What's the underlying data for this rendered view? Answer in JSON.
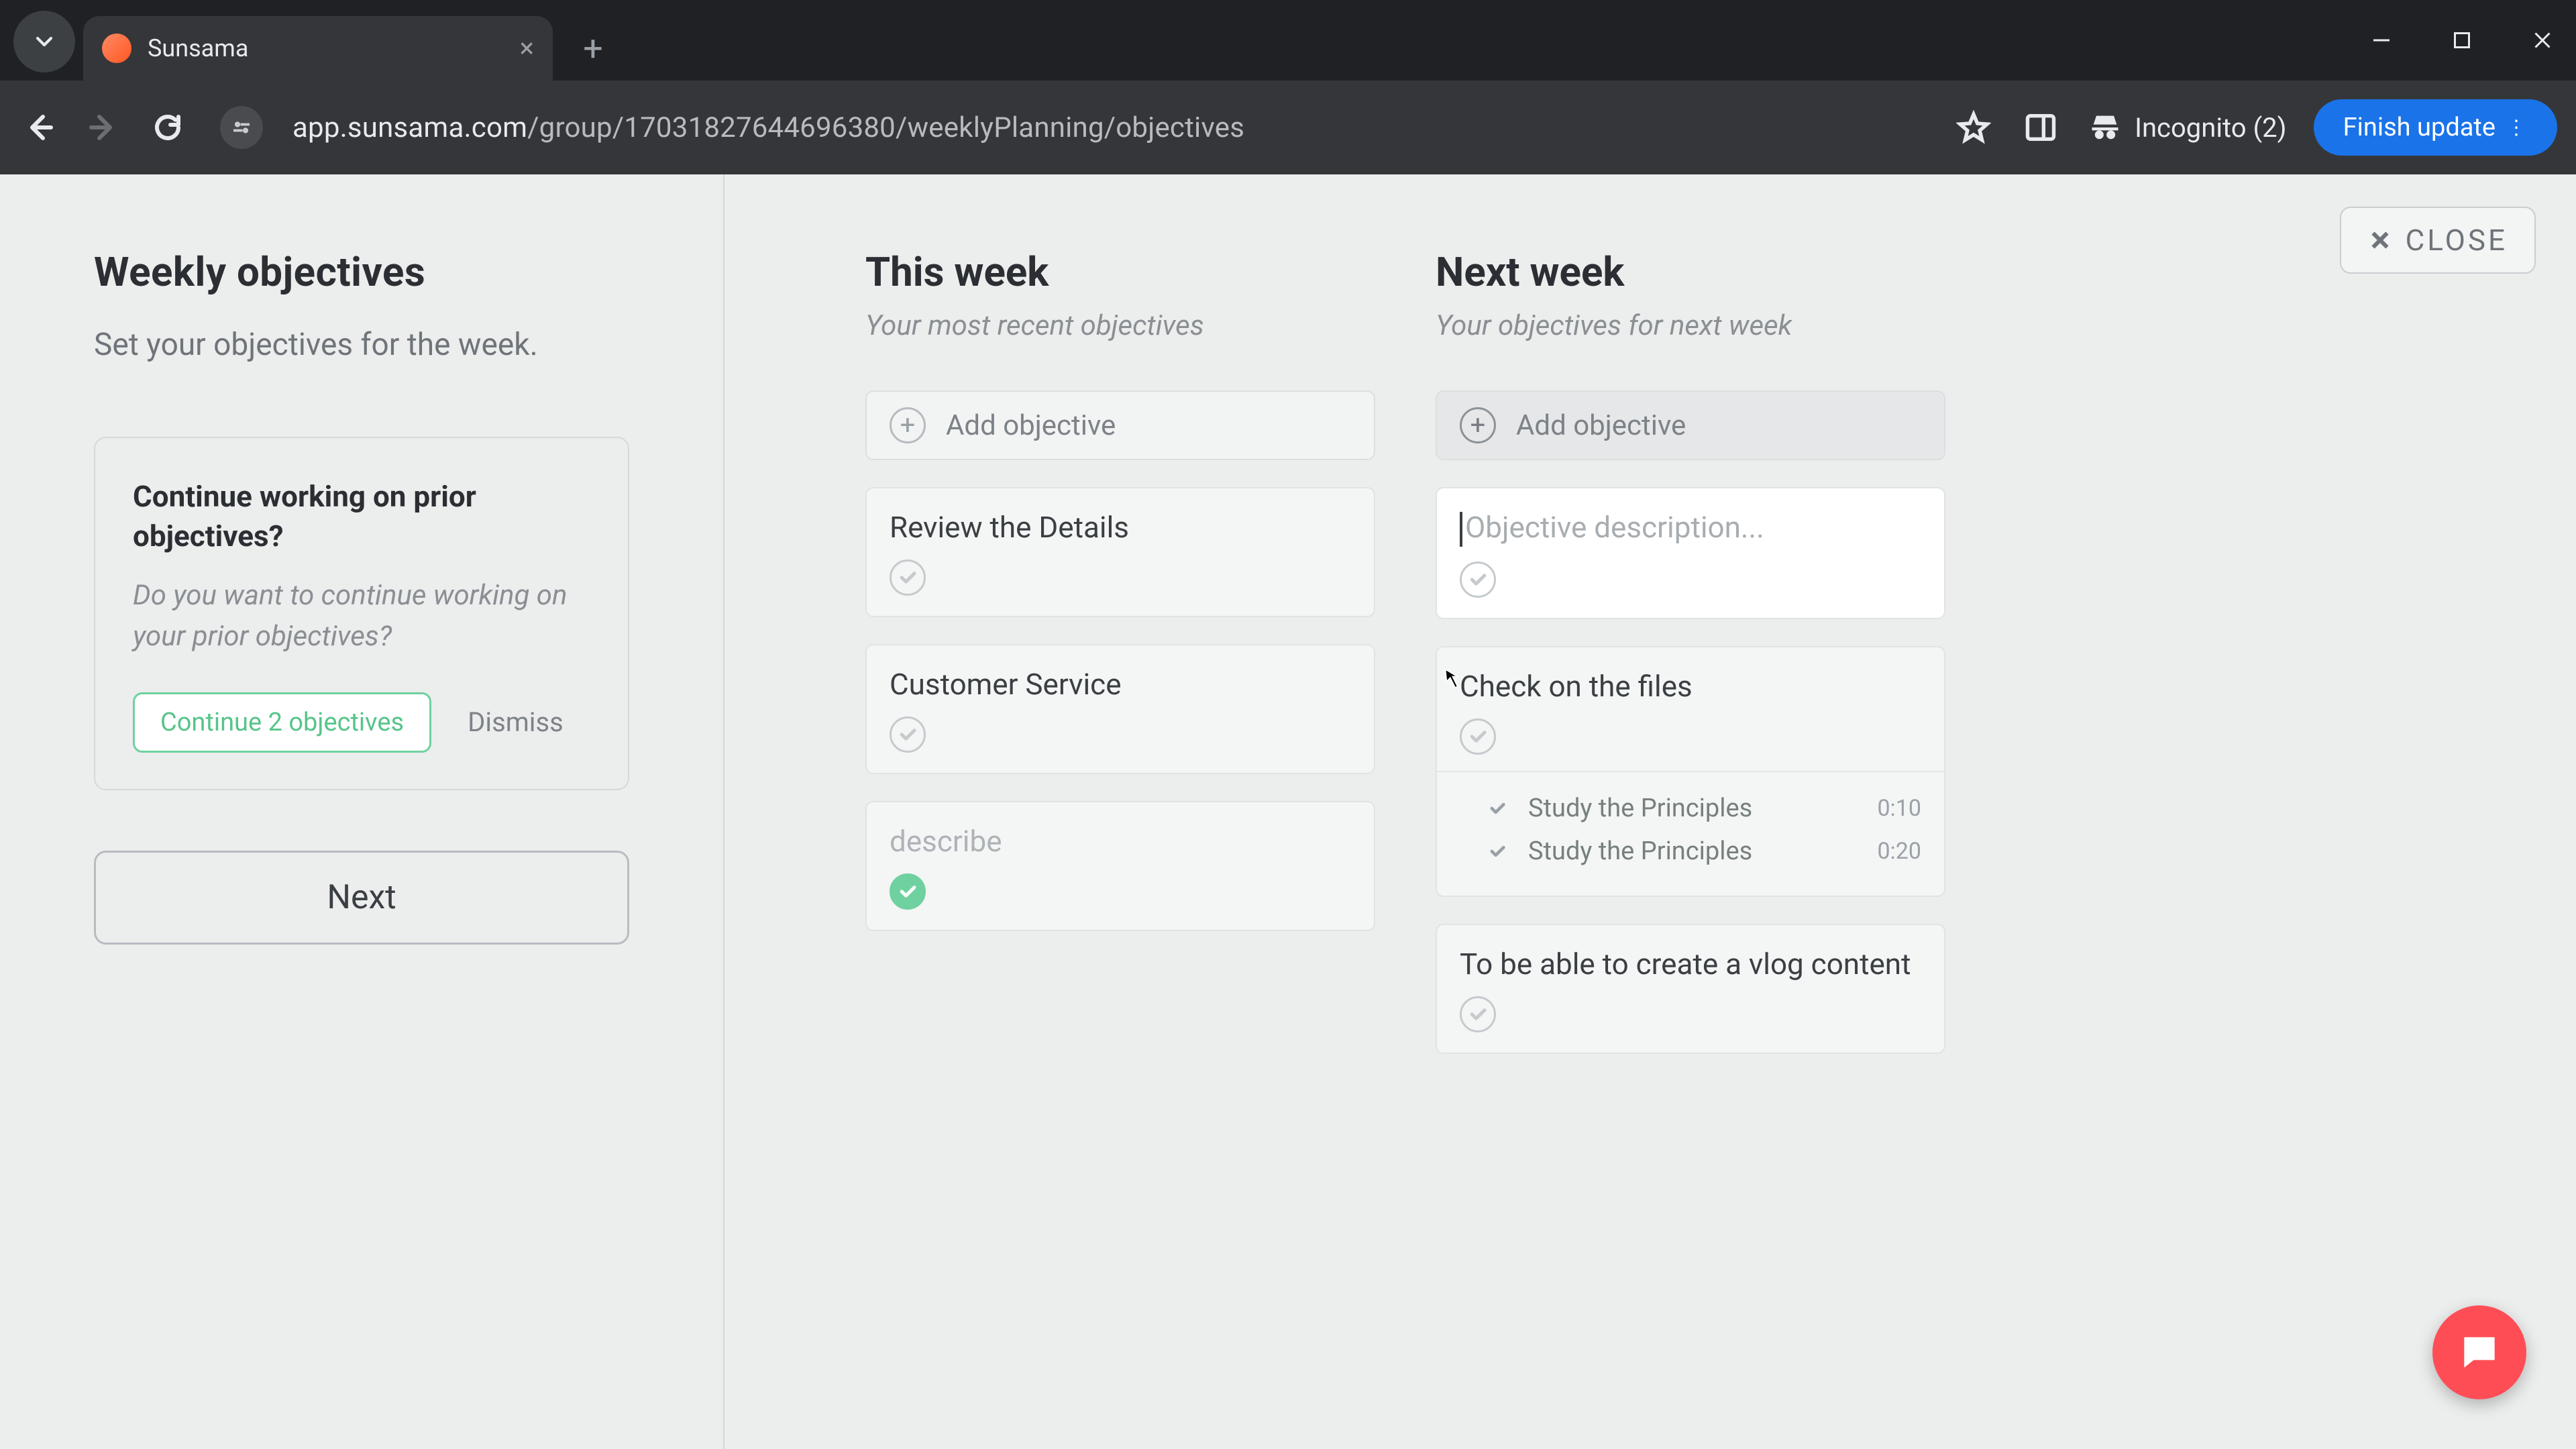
{
  "browser": {
    "tab_title": "Sunsama",
    "url_host": "app.sunsama.com",
    "url_path": "/group/17031827644696380/weeklyPlanning/objectives",
    "incognito_label": "Incognito (2)",
    "finish_update_label": "Finish update"
  },
  "close_label": "CLOSE",
  "sidebar": {
    "title": "Weekly objectives",
    "subtitle": "Set your objectives for the week.",
    "prompt": {
      "question": "Continue working on prior objectives?",
      "detail": "Do you want to continue working on your prior objectives?",
      "continue_label": "Continue 2 objectives",
      "dismiss_label": "Dismiss"
    },
    "next_label": "Next"
  },
  "this_week": {
    "heading": "This week",
    "subtitle": "Your most recent objectives",
    "add_label": "Add objective",
    "objectives": [
      {
        "title": "Review the Details",
        "done": false
      },
      {
        "title": "Customer Service",
        "done": false
      },
      {
        "title": "describe",
        "done": true
      }
    ]
  },
  "next_week": {
    "heading": "Next week",
    "subtitle": "Your objectives for next week",
    "add_label": "Add objective",
    "new_placeholder": "Objective description...",
    "objectives": [
      {
        "title": "Check on the files",
        "done": false,
        "subtasks": [
          {
            "name": "Study the Principles",
            "time": "0:10"
          },
          {
            "name": "Study the Principles",
            "time": "0:20"
          }
        ]
      },
      {
        "title": "To be able to create a vlog content",
        "done": false
      }
    ]
  }
}
